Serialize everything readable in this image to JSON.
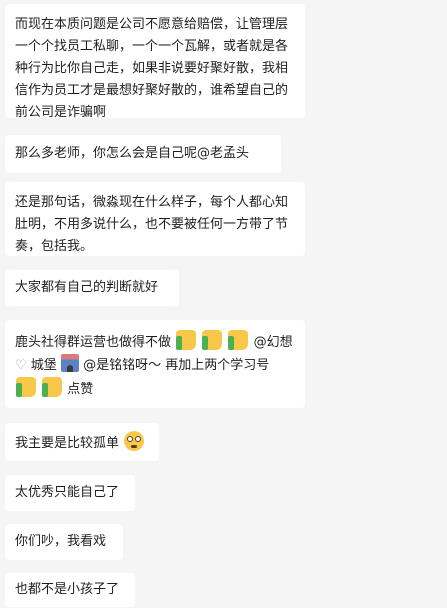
{
  "messages": [
    {
      "text": "而现在本质问题是公司不愿意给赔偿，让管理层一个个找员工私聊，一个一个瓦解，或者就是各种行为比你自己走，如果非说要好聚好散，我相信作为员工才是最想好聚好散的，谁希望自己的前公司是诈骗啊"
    },
    {
      "text": "那么多老师，你怎么会是自己呢@老孟头"
    },
    {
      "text": "还是那句话，微淼现在什么样子，每个人都心知肚明，不用多说什么，也不要被任何一方带了节奏，包括我。"
    },
    {
      "text": "大家都有自己的判断就好"
    },
    {
      "part1": "鹿头社得群运营也做得不做",
      "part2": "@幻想",
      "part3": " 城堡 ",
      "part4": " @是铭铭呀～ 再加上两个学习号",
      "part5": "点赞"
    },
    {
      "text": "我主要是比较孤单"
    },
    {
      "text": "太优秀只能自己了"
    },
    {
      "text": "你们吵，我看戏"
    },
    {
      "text": "也都不是小孩子了"
    }
  ],
  "emoji_names": [
    "thumbs-up-icon",
    "purple-heart-icon",
    "castle-icon",
    "flushed-face-icon"
  ]
}
